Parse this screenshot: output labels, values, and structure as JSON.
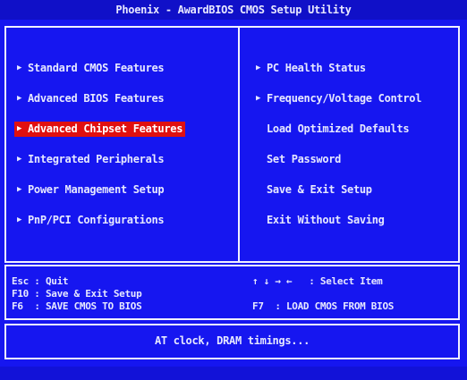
{
  "title": "Phoenix - AwardBIOS CMOS Setup Utility",
  "left_menu": [
    {
      "label": "Standard CMOS Features",
      "arrow": "▶"
    },
    {
      "label": "Advanced BIOS Features",
      "arrow": "▶"
    },
    {
      "label": "Advanced Chipset Features",
      "arrow": "▶",
      "selected": true
    },
    {
      "label": "Integrated Peripherals",
      "arrow": "▶"
    },
    {
      "label": "Power Management Setup",
      "arrow": "▶"
    },
    {
      "label": "PnP/PCI Configurations",
      "arrow": "▶"
    }
  ],
  "right_menu": [
    {
      "label": "PC Health Status",
      "arrow": "▶"
    },
    {
      "label": "Frequency/Voltage Control",
      "arrow": "▶"
    },
    {
      "label": "Load Optimized Defaults",
      "arrow": ""
    },
    {
      "label": "Set Password",
      "arrow": ""
    },
    {
      "label": "Save & Exit Setup",
      "arrow": ""
    },
    {
      "label": "Exit Without Saving",
      "arrow": ""
    }
  ],
  "help": {
    "esc_key": "Esc",
    "esc_label": ": Quit",
    "f10_key": "F10",
    "f10_label": ": Save & Exit Setup",
    "f6_key": "F6",
    "f6_label": ": SAVE CMOS TO BIOS",
    "select_keys": "↑ ↓ → ←",
    "select_label": ": Select Item",
    "f7_key": "F7",
    "f7_label": ": LOAD CMOS FROM BIOS"
  },
  "status": "AT clock, DRAM timings...",
  "colors": {
    "background": "#1616f0",
    "selected": "#e01010",
    "text": "#e6e8ff"
  }
}
